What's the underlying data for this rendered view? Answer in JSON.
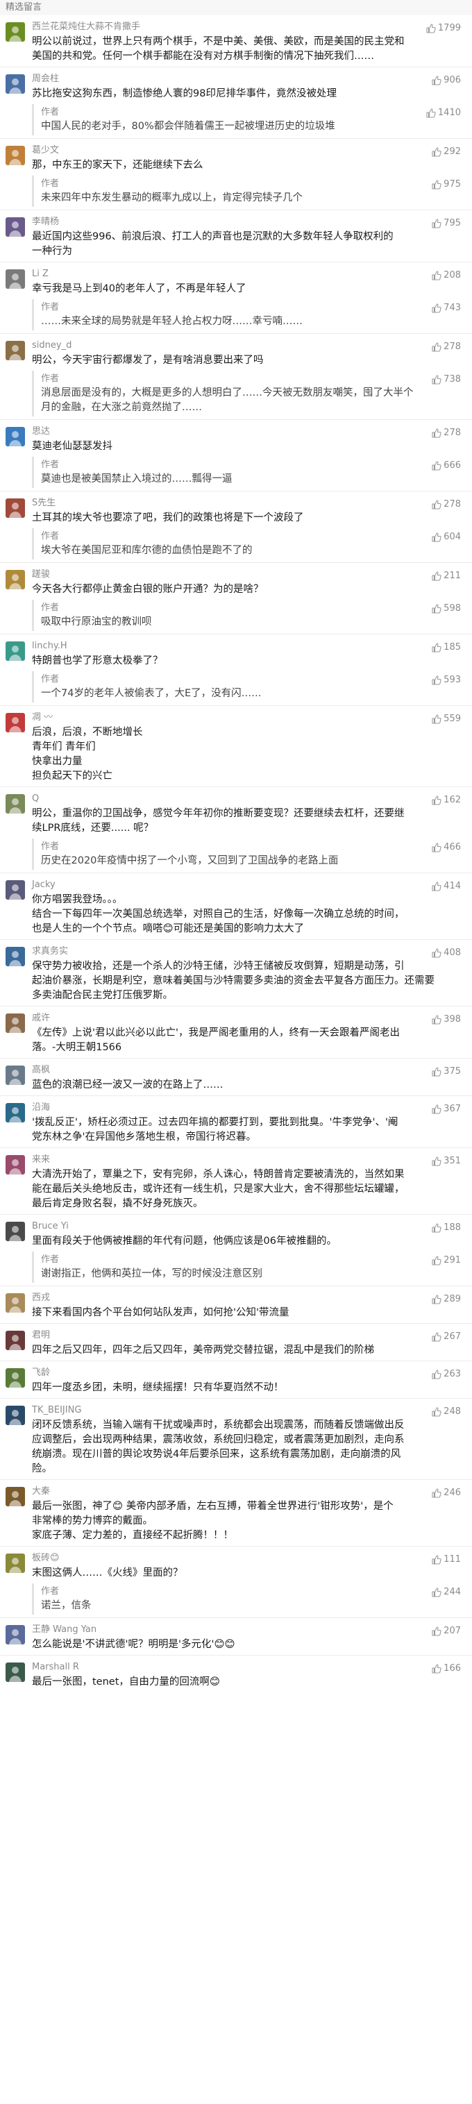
{
  "section_title": "精选留言",
  "reply_label": "作者",
  "comments": [
    {
      "author": "西兰花菜炖住大蒜不肯撒手",
      "likes": "1799",
      "color": "#6b8e23",
      "lines": [
        "明公以前说过，世界上只有两个棋手，不是中美、美俄、美欧，而是美国的民主党和",
        "美国的共和党。任何一个棋手都能在没有对方棋手制衡的情况下抽死我们……"
      ]
    },
    {
      "author": "周会柱",
      "likes": "906",
      "color": "#4a6fa5",
      "lines": [
        "苏比拖安这狗东西，制造惨绝人寰的98印尼排华事件，竟然没被处理"
      ],
      "reply": {
        "likes": "1410",
        "lines": [
          "中国人民的老对手，80%都会伴随着儒王一起被埋进历史的垃圾堆"
        ]
      }
    },
    {
      "author": "葛少文",
      "likes": "292",
      "color": "#c0803a",
      "lines": [
        "那，中东王的家天下，还能继续下去么"
      ],
      "reply": {
        "likes": "975",
        "lines": [
          "未来四年中东发生暴动的概率九成以上，肯定得完犊子几个"
        ]
      }
    },
    {
      "author": "李晴杨",
      "likes": "795",
      "color": "#6a5a8c",
      "lines": [
        "最近国内这些996、前浪后浪、打工人的声音也是沉默的大多数年轻人争取权利的",
        "一种行为"
      ]
    },
    {
      "author": "Li Z",
      "likes": "208",
      "color": "#7a7a7a",
      "lines": [
        "幸亏我是马上到40的老年人了，不再是年轻人了"
      ],
      "reply": {
        "likes": "743",
        "lines": [
          "……未来全球的局势就是年轻人抢占权力呀……幸亏喃……"
        ]
      }
    },
    {
      "author": "sidney_d",
      "likes": "278",
      "color": "#8b6f47",
      "lines": [
        "明公，今天宇宙行都爆发了，是有啥消息要出来了吗"
      ],
      "reply": {
        "likes": "738",
        "lines": [
          "消息层面是没有的，大概是更多的人想明白了……今天被无数朋友嘲笑，囤了大半个",
          "月的金融，在大涨之前竟然抛了……"
        ]
      }
    },
    {
      "author": "思达",
      "likes": "278",
      "color": "#3a7bbf",
      "lines": [
        "莫迪老仙瑟瑟发抖"
      ],
      "reply": {
        "likes": "666",
        "lines": [
          "莫迪也是被美国禁止入境过的……瓢得一逼"
        ]
      }
    },
    {
      "author": "S先生",
      "likes": "278",
      "color": "#a04a3a",
      "lines": [
        "土耳其的埃大爷也要凉了吧，我们的政策也将是下一个波段了"
      ],
      "reply": {
        "likes": "604",
        "lines": [
          "埃大爷在美国尼亚和库尔德的血债怕是跑不了的"
        ]
      }
    },
    {
      "author": "蹉骏",
      "likes": "211",
      "color": "#b08a3a",
      "lines": [
        "今天各大行都停止黄金白银的账户开通？为的是啥？"
      ],
      "reply": {
        "likes": "598",
        "lines": [
          "吸取中行原油宝的教训呗"
        ]
      }
    },
    {
      "author": "linchy.H",
      "likes": "185",
      "color": "#3a9a8a",
      "lines": [
        "特朗普也学了形意太极拳了？"
      ],
      "reply": {
        "likes": "593",
        "lines": [
          "一个74岁的老年人被偷表了，大E了，没有闪……"
        ]
      }
    },
    {
      "author": "凋 〰",
      "likes": "559",
      "color": "#c23b3b",
      "lines": [
        "后浪，后浪，不断地增长",
        "青年们  青年们",
        "快拿出力量",
        "担负起天下的兴亡"
      ]
    },
    {
      "author": "Q",
      "likes": "162",
      "color": "#7a8a5a",
      "lines": [
        "明公，重温你的卫国战争，感觉今年年初你的推断要变现？还要继续去杠杆，还要继",
        "续LPR底线，还要...... 呢？"
      ],
      "reply": {
        "likes": "466",
        "lines": [
          "历史在2020年疫情中拐了一个小弯，又回到了卫国战争的老路上面"
        ]
      }
    },
    {
      "author": "Jacky",
      "likes": "414",
      "color": "#5a5a7a",
      "lines": [
        "你方唱罢我登场。。。",
        "结合一下每四年一次美国总统选举，对照自己的生活，好像每一次确立总统的时间，",
        "也是人生的一个个节点。嘀嗒😊可能还是美国的影响力太大了"
      ]
    },
    {
      "author": "求真务实",
      "likes": "408",
      "color": "#3a6a9a",
      "lines": [
        "保守势力被收拾，还是一个杀人的沙特王储，沙特王储被反攻倒算，短期是动荡，引",
        "起油价暴涨，长期是利空，意味着美国与沙特需要多卖油的资金去平复各方面压力。还需要",
        "多卖油配合民主党打压俄罗斯。"
      ]
    },
    {
      "author": "戚许",
      "likes": "398",
      "color": "#8a6a4a",
      "lines": [
        "《左传》上说'君以此兴必以此亡'，我是严阁老重用的人，终有一天会跟着严阁老出",
        "落。-大明王朝1566"
      ]
    },
    {
      "author": "高枫",
      "likes": "375",
      "color": "#6a7a8a",
      "lines": [
        "蓝色的浪潮已经一波又一波的在路上了……"
      ]
    },
    {
      "author": "沿海",
      "likes": "367",
      "color": "#2a6a8a",
      "lines": [
        "'拨乱反正'，矫枉必须过正。过去四年搞的都要打到，要批到批臭。'牛李党争'、'阉",
        "党东林之争'在异国他乡落地生根，帝国行将迟暮。"
      ]
    },
    {
      "author": "来来",
      "likes": "351",
      "color": "#9a4a6a",
      "lines": [
        "大清洗开始了，覃巢之下，安有完卵，杀人诛心，特朗普肯定要被清洗的，当然如果",
        "能在最后关头绝地反击，或许还有一线生机，只是家大业大，舍不得那些坛坛罐罐，",
        "最后肯定身败名裂，撬不好身死族灭。"
      ]
    },
    {
      "author": "Bruce Yi",
      "likes": "188",
      "color": "#4a4a4a",
      "lines": [
        "里面有段关于他俩被推翻的年代有问题，他俩应该是06年被推翻的。"
      ],
      "reply": {
        "likes": "291",
        "lines": [
          "谢谢指正，他俩和英拉一体，写的时候没注意区别"
        ]
      }
    },
    {
      "author": "西戎",
      "likes": "289",
      "color": "#aa8a5a",
      "lines": [
        "接下来看国内各个平台如何站队发声，如何抢'公知'带流量"
      ]
    },
    {
      "author": "君明",
      "likes": "267",
      "color": "#6a3a3a",
      "lines": [
        "四年之后又四年，四年之后又四年，美帝两党交替拉锯，混乱中是我们的阶梯"
      ]
    },
    {
      "author": "飞龄",
      "likes": "263",
      "color": "#5a7a3a",
      "lines": [
        "四年一度丞乡团，未明，继续摇摆！只有华夏岿然不动！"
      ]
    },
    {
      "author": "TK_BEIJING",
      "likes": "248",
      "color": "#2a4a6a",
      "lines": [
        "闭环反馈系统，当输入端有干扰或噪声时，系统都会出现震荡，而随着反馈端做出反",
        "应调整后，会出现两种结果，震荡收敛，系统回归稳定，或者震荡更加剧烈，走向系",
        "统崩溃。现在川普的舆论攻势说4年后要杀回来，这系统有震荡加剧，走向崩溃的风",
        "险。"
      ]
    },
    {
      "author": "大秦",
      "likes": "246",
      "color": "#7a5a2a",
      "lines": [
        "最后一张图，神了😊  美帝内部矛盾，左右互搏，带着全世界进行'钳形攻势'，是个",
        "非常棒的势力博弈的戴面。",
        "家底子薄、定力差的，直接经不起折腾！！！"
      ]
    },
    {
      "author": "板砖😊",
      "likes": "111",
      "color": "#8a8a3a",
      "lines": [
        "末图这俩人……《火线》里面的？"
      ],
      "reply": {
        "likes": "244",
        "lines": [
          "诺兰，信条"
        ]
      }
    },
    {
      "author": "王静 Wang Yan",
      "likes": "207",
      "color": "#5a6a9a",
      "lines": [
        "怎么能说是'不讲武德'呢？明明是'多元化'😊😊"
      ]
    },
    {
      "author": "Marshall R",
      "likes": "166",
      "color": "#3a5a4a",
      "lines": [
        "最后一张图，tenet，自由力量的回流啊😊"
      ]
    }
  ]
}
